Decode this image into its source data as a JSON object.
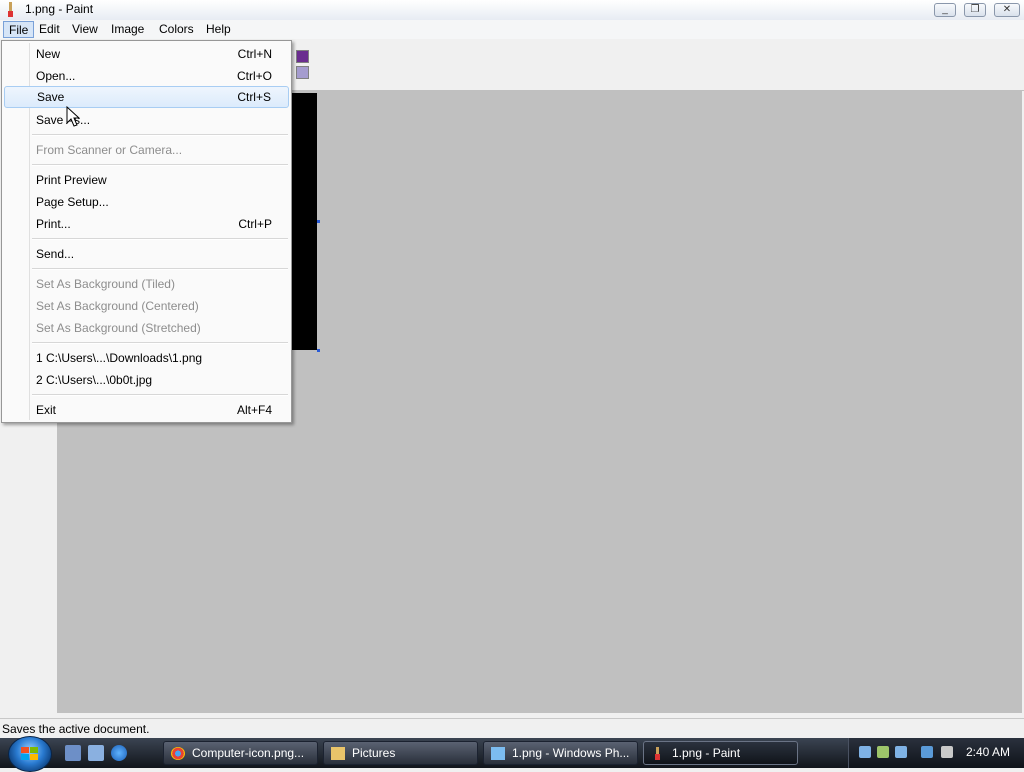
{
  "window": {
    "title": "1.png - Paint"
  },
  "menubar": {
    "items": [
      "File",
      "Edit",
      "View",
      "Image",
      "Colors",
      "Help"
    ],
    "active": "File"
  },
  "file_menu": {
    "new": {
      "label": "New",
      "shortcut": "Ctrl+N"
    },
    "open": {
      "label": "Open...",
      "shortcut": "Ctrl+O"
    },
    "save": {
      "label": "Save",
      "shortcut": "Ctrl+S"
    },
    "save_as": {
      "label": "Save As..."
    },
    "from_scanner": {
      "label": "From Scanner or Camera..."
    },
    "print_preview": {
      "label": "Print Preview"
    },
    "page_setup": {
      "label": "Page Setup..."
    },
    "print": {
      "label": "Print...",
      "shortcut": "Ctrl+P"
    },
    "send": {
      "label": "Send..."
    },
    "bg_tiled": {
      "label": "Set As Background (Tiled)"
    },
    "bg_centered": {
      "label": "Set As Background (Centered)"
    },
    "bg_stretched": {
      "label": "Set As Background (Stretched)"
    },
    "recent1": {
      "label": "1 C:\\Users\\...\\Downloads\\1.png"
    },
    "recent2": {
      "label": "2 C:\\Users\\...\\0b0t.jpg"
    },
    "exit": {
      "label": "Exit",
      "shortcut": "Alt+F4"
    }
  },
  "statusbar": {
    "text": "Saves the active document."
  },
  "taskbar": {
    "buttons": [
      {
        "label": "Computer-icon.png..."
      },
      {
        "label": "Pictures"
      },
      {
        "label": "1.png - Windows Ph..."
      },
      {
        "label": "1.png - Paint"
      }
    ],
    "clock": "2:40 AM"
  },
  "colors": {
    "accent": "#d6e5f7",
    "swatch_dark": "#6a2d8f",
    "swatch_light": "#a59ccf"
  },
  "icons": [
    "paint-app-icon",
    "minimize-icon",
    "maximize-icon",
    "close-icon",
    "windows-logo-icon",
    "show-desktop-icon",
    "switch-windows-icon",
    "internet-explorer-icon",
    "chrome-icon",
    "folder-icon",
    "photo-viewer-icon",
    "network-icon",
    "volume-muted-icon",
    "mouse-cursor-icon"
  ]
}
